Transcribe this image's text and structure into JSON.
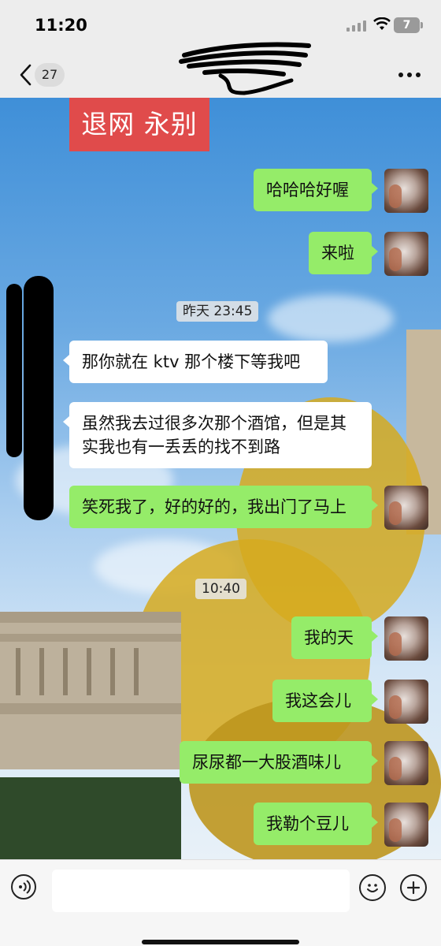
{
  "status_bar": {
    "time": "11:20",
    "battery": "7"
  },
  "nav": {
    "unread_count": "27"
  },
  "banner": {
    "text": "退网 永别"
  },
  "messages": [
    {
      "side": "out",
      "text": "哈哈哈好喔"
    },
    {
      "side": "out",
      "text": "来啦"
    },
    {
      "side": "time",
      "text": "昨天 23:45"
    },
    {
      "side": "in",
      "text": "那你就在 ktv 那个楼下等我吧"
    },
    {
      "side": "in",
      "text": "虽然我去过很多次那个酒馆，但是其实我也有一丢丢的找不到路"
    },
    {
      "side": "out",
      "text": "笑死我了，好的好的，我出门了马上"
    },
    {
      "side": "time",
      "text": "10:40"
    },
    {
      "side": "out",
      "text": "我的天"
    },
    {
      "side": "out",
      "text": "我这会儿"
    },
    {
      "side": "out",
      "text": "尿尿都一大股酒味儿"
    },
    {
      "side": "out",
      "text": "我勒个豆儿"
    }
  ],
  "input": {
    "placeholder": ""
  },
  "colors": {
    "outgoing_bubble": "#95ec69",
    "incoming_bubble": "#ffffff",
    "bar_bg": "#ededed"
  }
}
